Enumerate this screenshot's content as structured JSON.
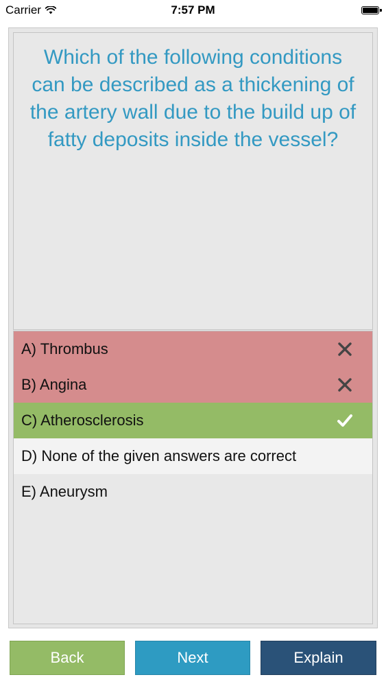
{
  "status_bar": {
    "carrier": "Carrier",
    "time": "7:57 PM",
    "wifi_icon": "wifi-icon",
    "battery_icon": "battery-full-icon"
  },
  "question": {
    "text": "Which of the following conditions can be described as a thickening of the artery wall due to the build up of fatty deposits inside the vessel?"
  },
  "answers": [
    {
      "label": "A) Thrombus",
      "state": "wrong",
      "icon": "cross-icon"
    },
    {
      "label": "B) Angina",
      "state": "wrong",
      "icon": "cross-icon"
    },
    {
      "label": "C) Atherosclerosis",
      "state": "correct",
      "icon": "checkmark-icon"
    },
    {
      "label": "D) None of the given answers are correct",
      "state": "neutral-highlight"
    },
    {
      "label": "E) Aneurysm",
      "state": "neutral"
    }
  ],
  "buttons": {
    "back": "Back",
    "next": "Next",
    "explain": "Explain"
  },
  "colors": {
    "question_text": "#3399c2",
    "wrong": "#d58c8d",
    "correct": "#94bb66",
    "back_button": "#94bb66",
    "next_button": "#2e9bc2",
    "explain_button": "#2a5278"
  }
}
